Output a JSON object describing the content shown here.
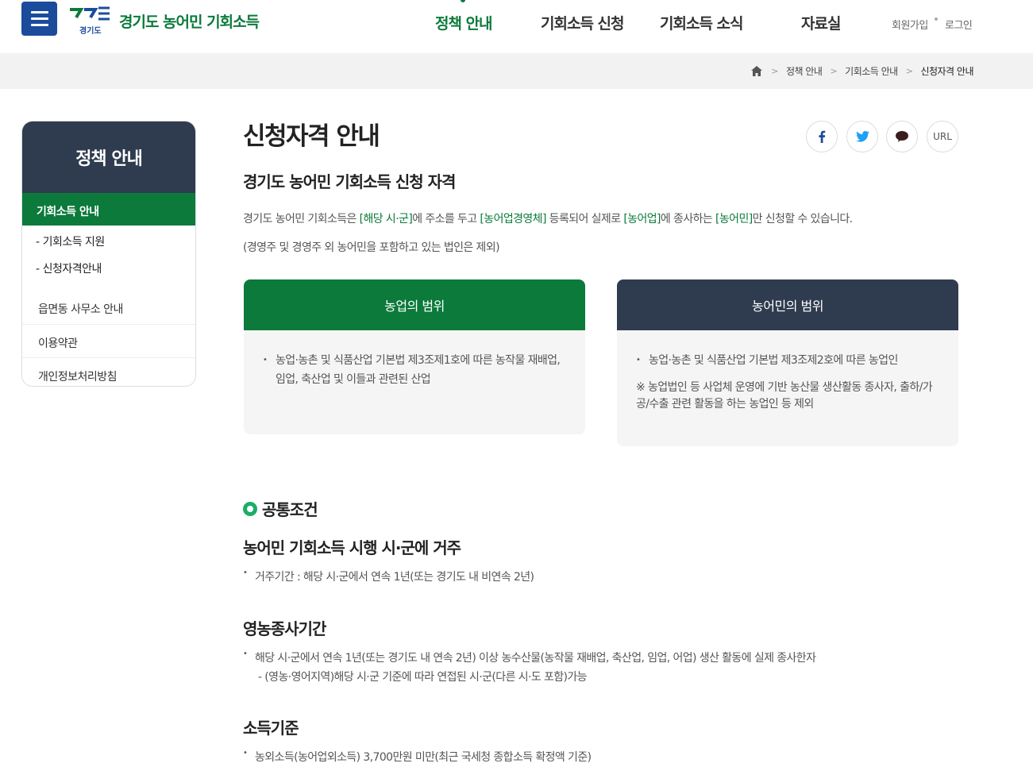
{
  "header": {
    "logo_sub": "경기도",
    "site_title": "경기도 농어민 기회소득",
    "nav": [
      "정책 안내",
      "기회소득 신청",
      "기회소득 소식",
      "자료실"
    ],
    "join": "회원가입",
    "login": "로그인"
  },
  "breadcrumb": [
    "정책 안내",
    "기회소득 안내",
    "신청자격 안내"
  ],
  "sidebar": {
    "title": "정책 안내",
    "active": "기회소득 안내",
    "sub_items": [
      "기회소득 지원",
      "신청자격안내"
    ],
    "items": [
      "읍면동 사무소 안내",
      "이용약관",
      "개인정보처리방침"
    ]
  },
  "main": {
    "page_title": "신청자격 안내",
    "share": {
      "url_label": "URL"
    },
    "sub_title": "경기도 농어민 기회소득 신청 자격",
    "desc": {
      "p1": "경기도 농어민 기회소득은 ",
      "h1": "[해당 시·군]",
      "p2": "에 주소를 두고 ",
      "h2": "[농어업경영체]",
      "p3": " 등록되어 실제로 ",
      "h3": "[농어업]",
      "p4": "에 종사하는 ",
      "h4": "[농어민]",
      "p5": "만 신청할 수 있습니다."
    },
    "desc2": "(경영주 및 경영주 외 농어민을 포함하고 있는 법인은 제외)",
    "card1": {
      "title": "농업의 범위",
      "bullet": "농업·농촌 및 식품산업 기본법 제3조제1호에 따른 농작물 재배업, 임업, 축산업 및 이들과 관련된 산업"
    },
    "card2": {
      "title": "농어민의 범위",
      "bullet": "농업·농촌 및 식품산업 기본법 제3조제2호에 따른 농업인",
      "note": "※ 농업법인 등 사업체 운영에 기반 농산물 생산활동 종사자, 출하/가공/수출 관련 활동을 하는 농업인 등 제외"
    },
    "common": {
      "title": "공통조건",
      "residence_title": "농어민 기회소득 시행 시·군에 거주",
      "residence_item": "거주기간 : 해당 시·군에서 연속 1년(또는 경기도 내 비연속 2년)",
      "period_title": "영농종사기간",
      "period_item": "해당 시·군에서 연속 1년(또는 경기도 내 연속 2년) 이상 농수산물(농작물 재배업, 축산업, 임업, 어업) 생산 활동에 실제 종사한자",
      "period_sub": "- (영농·영어지역)해당 시·군 기준에 따라 연접된 시·군(다른 시·도 포함)가능",
      "income_title": "소득기준",
      "income_item": "농외소득(농어업외소득) 3,700만원 미만(최근 국세청 종합소득 확정액 기준)"
    }
  },
  "colors": {
    "brand_green": "#0b7a3b",
    "brand_blue": "#1b4c9c",
    "navy": "#2f3b4f"
  }
}
